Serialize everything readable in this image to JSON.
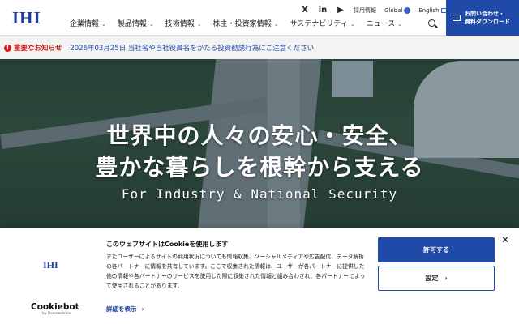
{
  "header": {
    "logo": "IHI",
    "nav": [
      {
        "label": "企業情報",
        "icon": "chevron-down-icon"
      },
      {
        "label": "製品情報",
        "icon": "chevron-down-icon"
      },
      {
        "label": "技術情報",
        "icon": "chevron-down-icon"
      },
      {
        "label": "株主・投資家情報",
        "icon": "chevron-down-icon"
      },
      {
        "label": "サステナビリティ",
        "icon": "chevron-down-icon"
      },
      {
        "label": "ニュース",
        "icon": "chevron-down-icon"
      }
    ],
    "utility": {
      "x_glyph": "X",
      "linkedin_glyph": "in",
      "youtube_glyph": "▶",
      "recruit": "採用情報",
      "global": "Global",
      "english": "English"
    },
    "contact": {
      "line1": "お問い合わせ・",
      "line2": "資料ダウンロード"
    }
  },
  "notice": {
    "icon_glyph": "!",
    "label": "重要なお知らせ",
    "text": "2026年03月25日 当社名や当社役員名をかたる投資勧誘行為にご注意ください"
  },
  "hero": {
    "headline1": "世界中の人々の安心・安全、",
    "headline2": "豊かな暮らしを根幹から支える",
    "tagline": "For Industry & National Security"
  },
  "cookie": {
    "logo": "IHI",
    "title": "このウェブサイトはCookieを使用します",
    "body": "またユーザーによるサイトの利用状況についても情報収集、ソーシャルメディアや広告配信、データ解析の各パートナーに情報を共有しています。ここで収集された情報は、ユーザーが各パートナーに提供した他の情報や各パートナーのサービスを使用した際に収集された情報と組み合わされ、各パートナーによって使用されることがあります。",
    "details": "詳細を表示",
    "details_arrow": "›",
    "allow": "許可する",
    "settings": "設定",
    "settings_arrow": "›",
    "close": "✕",
    "cookiebot": "Cookiebot",
    "cookiebot_by": "by Usercentrics"
  },
  "colors": {
    "brand": "#1f4aa8",
    "notice": "#d21e1e"
  }
}
